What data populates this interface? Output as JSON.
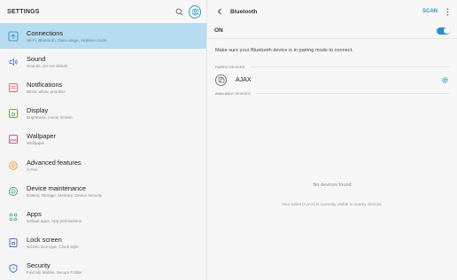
{
  "settings": {
    "title": "SETTINGS",
    "items": [
      {
        "label": "Connections",
        "sub": "Wi-Fi, Bluetooth, Data usage, Airplane mode",
        "icon": "connections-icon",
        "selected": true
      },
      {
        "label": "Sound",
        "sub": "Sounds, Do not disturb",
        "icon": "sound-icon"
      },
      {
        "label": "Notifications",
        "sub": "Block, allow, prioritize",
        "icon": "notifications-icon"
      },
      {
        "label": "Display",
        "sub": "Brightness, Home screen",
        "icon": "display-icon"
      },
      {
        "label": "Wallpaper",
        "sub": "Wallpaper",
        "icon": "wallpaper-icon"
      },
      {
        "label": "Advanced features",
        "sub": "S Pen",
        "icon": "advanced-features-icon"
      },
      {
        "label": "Device maintenance",
        "sub": "Battery, Storage, Memory, Device security",
        "icon": "device-maintenance-icon"
      },
      {
        "label": "Apps",
        "sub": "Default apps, App permissions",
        "icon": "apps-icon"
      },
      {
        "label": "Lock screen",
        "sub": "Screen lock type, Clock style",
        "icon": "lock-screen-icon"
      },
      {
        "label": "Security",
        "sub": "Find My Mobile, Secure Folder",
        "icon": "security-icon"
      }
    ]
  },
  "bluetooth": {
    "title": "Bluetooth",
    "scan": "SCAN",
    "state": "ON",
    "hint": "Make sure your Bluetooth device is in pairing mode to connect.",
    "paired_header": "PAIRED DEVICES",
    "paired": [
      {
        "name": "AJAX"
      }
    ],
    "available_header": "AVAILABLE DEVICES",
    "no_devices": "No devices found",
    "visible_msg": "Your tablet (AJAX) is currently visible to nearby devices."
  },
  "colors": {
    "accent": "#2a90c6",
    "selected_bg": "#b8dcef"
  }
}
